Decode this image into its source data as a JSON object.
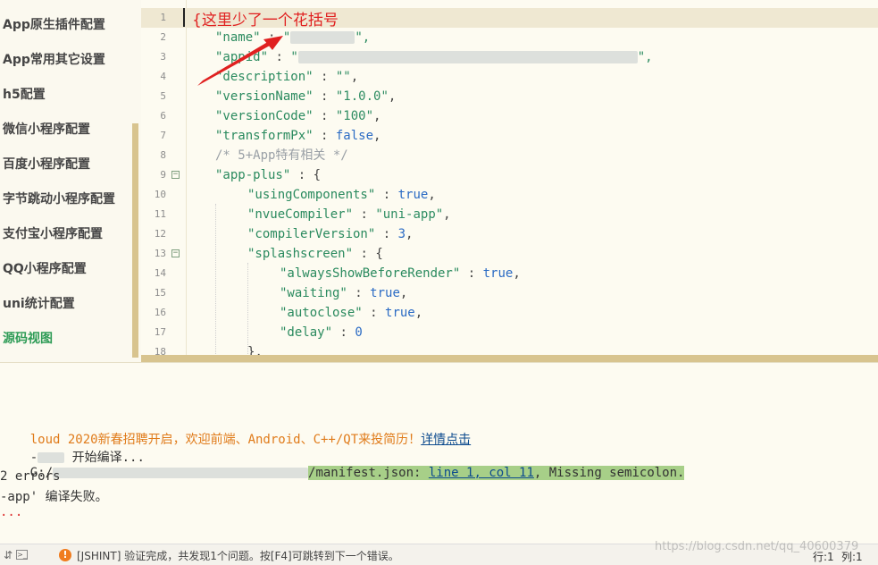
{
  "sidebar": {
    "items": [
      {
        "label": "App原生插件配置"
      },
      {
        "label": "App常用其它设置"
      },
      {
        "label": "h5配置"
      },
      {
        "label": "微信小程序配置"
      },
      {
        "label": "百度小程序配置"
      },
      {
        "label": "字节跳动小程序配置"
      },
      {
        "label": "支付宝小程序配置"
      },
      {
        "label": "QQ小程序配置"
      },
      {
        "label": "uni统计配置"
      },
      {
        "label": "源码视图"
      }
    ]
  },
  "editor": {
    "annotation": "{这里少了一个花括号",
    "line_numbers": [
      "1",
      "2",
      "3",
      "4",
      "5",
      "6",
      "7",
      "8",
      "9",
      "10",
      "11",
      "12",
      "13",
      "14",
      "15",
      "16",
      "17",
      "18"
    ],
    "lines": {
      "l2_key": "\"name\"",
      "l2_sep": " : ",
      "l2_open": "\"",
      "l2_close": "\",",
      "l3_key": "\"appid\"",
      "l3_sep": " : ",
      "l3_open": "\"",
      "l3_close": "\",",
      "l4_key": "\"description\"",
      "l4_sep": " : ",
      "l4_val": "\"\"",
      "l4_end": ",",
      "l5_key": "\"versionName\"",
      "l5_sep": " : ",
      "l5_val": "\"1.0.0\"",
      "l5_end": ",",
      "l6_key": "\"versionCode\"",
      "l6_sep": " : ",
      "l6_val": "\"100\"",
      "l6_end": ",",
      "l7_key": "\"transformPx\"",
      "l7_sep": " : ",
      "l7_val": "false",
      "l7_end": ",",
      "l8_comment": "/* 5+App特有相关 */",
      "l9_key": "\"app-plus\"",
      "l9_sep": " : ",
      "l9_val": "{",
      "l10_key": "\"usingComponents\"",
      "l10_sep": " : ",
      "l10_val": "true",
      "l10_end": ",",
      "l11_key": "\"nvueCompiler\"",
      "l11_sep": " : ",
      "l11_val": "\"uni-app\"",
      "l11_end": ",",
      "l12_key": "\"compilerVersion\"",
      "l12_sep": " : ",
      "l12_val": "3",
      "l12_end": ",",
      "l13_key": "\"splashscreen\"",
      "l13_sep": " : ",
      "l13_val": "{",
      "l14_key": "\"alwaysShowBeforeRender\"",
      "l14_sep": " : ",
      "l14_val": "true",
      "l14_end": ",",
      "l15_key": "\"waiting\"",
      "l15_sep": " : ",
      "l15_val": "true",
      "l15_end": ",",
      "l16_key": "\"autoclose\"",
      "l16_sep": " : ",
      "l16_val": "true",
      "l16_end": ",",
      "l17_key": "\"delay\"",
      "l17_sep": " : ",
      "l17_val": "0",
      "l18_text": "},"
    }
  },
  "console": {
    "line1_text": "loud 2020新春招聘开启，欢迎前端、Android、C++/QT来投简历！",
    "line1_link": "详情点击",
    "line2_prefix": "-",
    "line2_text": "开始编译...",
    "line3_prefix": "G:/",
    "line3_file": "/manifest.json: ",
    "line3_link": "line 1, col 11",
    "line3_msg": ", Missing semicolon.",
    "line4_text": "2 errors",
    "line5_text": "-app' 编译失败。",
    "line6_text": "..."
  },
  "statusbar": {
    "warning_icon": "!",
    "message": "[JSHINT] 验证完成，共发现1个问题。按[F4]可跳转到下一个错误。",
    "row": "行:1",
    "col": "列:1",
    "watermark": "https://blog.csdn.net/qq_40600379"
  },
  "colors": {
    "accent_green": "#2f9c57",
    "error_red": "#e02020",
    "console_orange": "#e07b1a",
    "error_highlight": "#a7cf88",
    "warning_orange": "#f07c1e"
  }
}
